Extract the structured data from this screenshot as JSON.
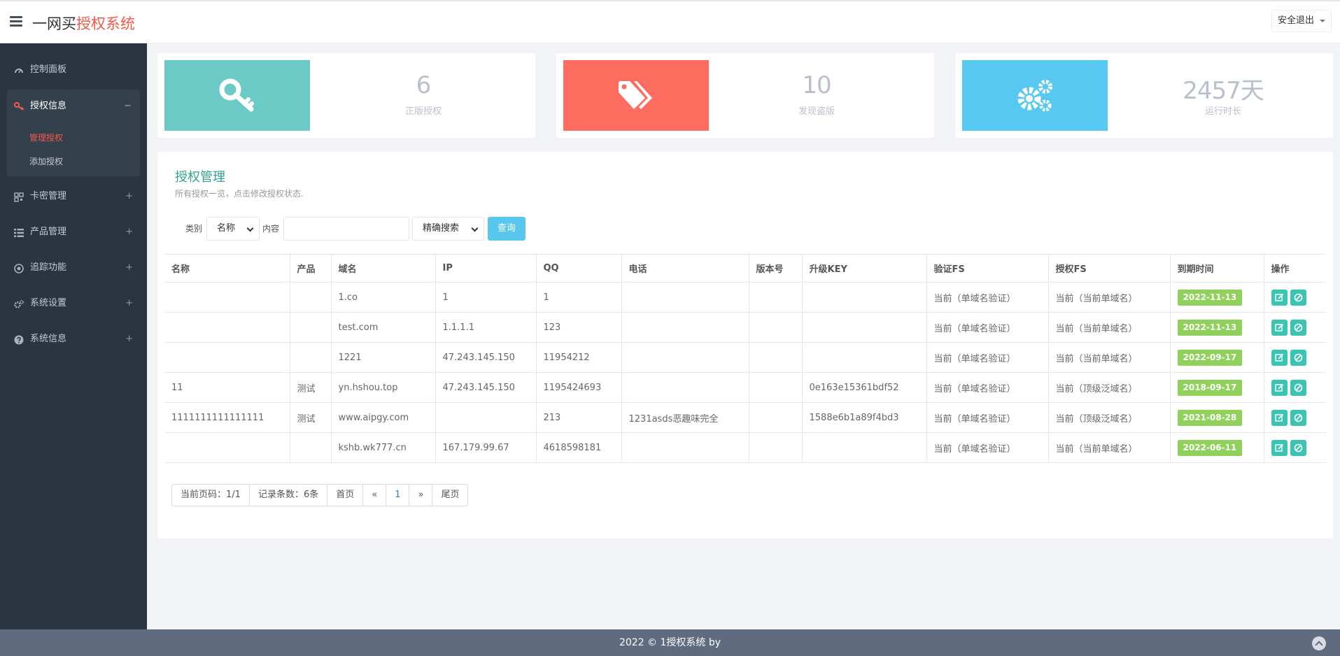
{
  "header": {
    "brand_prefix": "一网买",
    "brand_accent": "授权系统",
    "logout_label": "安全退出"
  },
  "sidebar": {
    "items": [
      {
        "label": "控制面板",
        "icon": "dashboard-icon"
      },
      {
        "label": "授权信息",
        "icon": "key-icon",
        "toggle": "−",
        "expanded": true
      },
      {
        "label": "卡密管理",
        "icon": "barcode-icon",
        "toggle": "+"
      },
      {
        "label": "产品管理",
        "icon": "list-icon",
        "toggle": "+"
      },
      {
        "label": "追踪功能",
        "icon": "target-icon",
        "toggle": "+"
      },
      {
        "label": "系统设置",
        "icon": "gears-icon",
        "toggle": "+"
      },
      {
        "label": "系统信息",
        "icon": "question-icon",
        "toggle": "+"
      }
    ],
    "subitems": [
      {
        "label": "管理授权",
        "active": true
      },
      {
        "label": "添加授权",
        "active": false
      }
    ]
  },
  "stats": [
    {
      "value": "6",
      "caption": "正版授权",
      "icon": "key-icon",
      "color": "#6ccac6"
    },
    {
      "value": "10",
      "caption": "发现盗版",
      "icon": "tags-icon",
      "color": "#ff6c60"
    },
    {
      "value": "2457天",
      "caption": "运行时长",
      "icon": "gears-icon",
      "color": "#57c8f2"
    }
  ],
  "panel": {
    "title": "授权管理",
    "subtitle": "所有授权一览，点击修改授权状态."
  },
  "search": {
    "type_label": "类别",
    "type_value": "名称",
    "content_label": "内容",
    "content_value": "",
    "mode_value": "精确搜索",
    "query_label": "查询"
  },
  "table": {
    "columns": [
      "名称",
      "产品",
      "域名",
      "IP",
      "QQ",
      "电话",
      "版本号",
      "升级KEY",
      "验证FS",
      "授权FS",
      "到期时间",
      "操作"
    ],
    "rows": [
      [
        "",
        "",
        "1.co",
        "1",
        "1",
        "",
        "",
        "",
        "当前（单域名验证）",
        "当前（当前单域名）",
        "2022-11-13"
      ],
      [
        "",
        "",
        "test.com",
        "1.1.1.1",
        "123",
        "",
        "",
        "",
        "当前（单域名验证）",
        "当前（当前单域名）",
        "2022-11-13"
      ],
      [
        "",
        "",
        "1221",
        "47.243.145.150",
        "11954212",
        "",
        "",
        "",
        "当前（单域名验证）",
        "当前（当前单域名）",
        "2022-09-17"
      ],
      [
        "11",
        "测试",
        "yn.hshou.top",
        "47.243.145.150",
        "1195424693",
        "",
        "",
        "0e163e15361bdf52",
        "当前（单域名验证）",
        "当前（顶级泛域名）",
        "2018-09-17"
      ],
      [
        "1111111111111111",
        "测试",
        "www.aipgy.com",
        "",
        "213",
        "1231asds恶趣味完全",
        "",
        "1588e6b1a89f4bd3",
        "当前（单域名验证）",
        "当前（顶级泛域名）",
        "2021-08-28"
      ],
      [
        "",
        "",
        "kshb.wk777.cn",
        "167.179.99.67",
        "4618598181",
        "",
        "",
        "",
        "当前（单域名验证）",
        "当前（当前单域名）",
        "2022-06-11"
      ]
    ]
  },
  "pager": {
    "current_page": "当前页码：1/1",
    "record_count": "记录条数：6条",
    "first": "首页",
    "prev": "«",
    "page": "1",
    "next": "»",
    "last": "尾页"
  },
  "footer": {
    "text": "2022 © 1授权系统 by"
  }
}
